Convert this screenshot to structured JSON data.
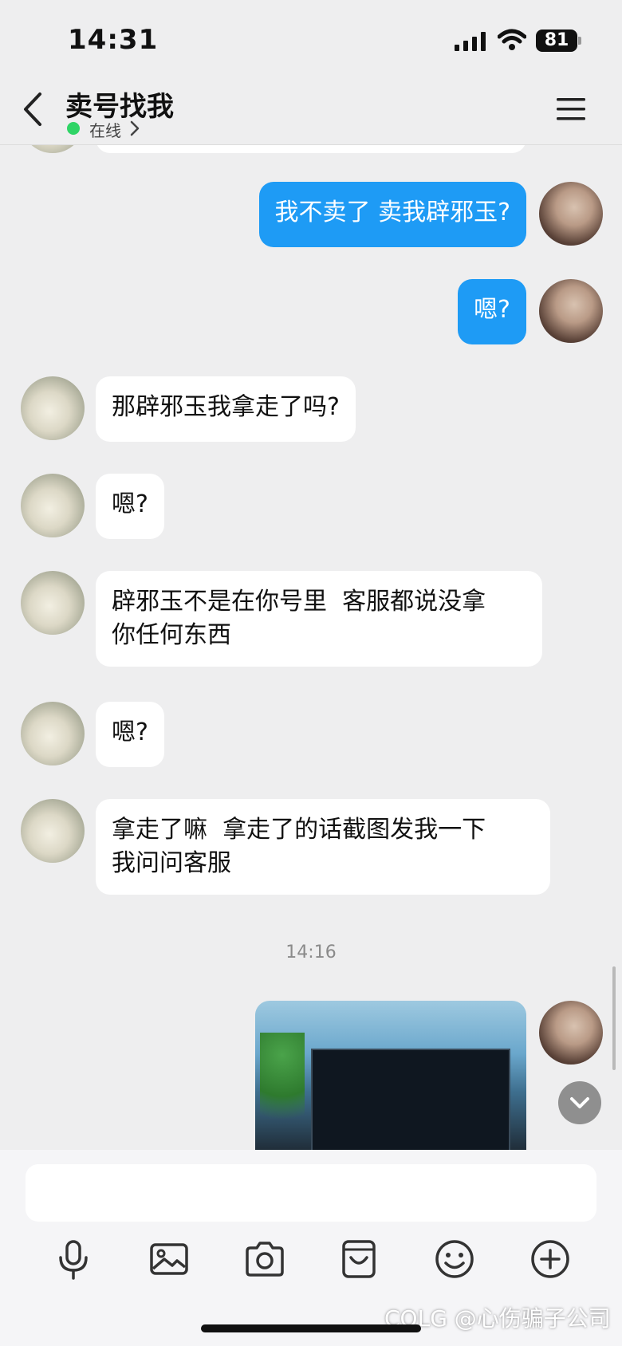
{
  "status_bar": {
    "time": "14:31",
    "battery": "81"
  },
  "header": {
    "title": "卖号找我",
    "status": "在线"
  },
  "messages": [
    {
      "side": "self",
      "text": "我不卖了 卖我辟邪玉?"
    },
    {
      "side": "self",
      "text": "嗯?"
    },
    {
      "side": "other",
      "text": "那辟邪玉我拿走了吗?"
    },
    {
      "side": "other",
      "text": "嗯?"
    },
    {
      "side": "other",
      "text": "辟邪玉不是在你号里  客服都说没拿\n你任何东西"
    },
    {
      "side": "other",
      "text": "嗯?"
    },
    {
      "side": "other",
      "text": "拿走了嘛  拿走了的话截图发我一下\n我问问客服"
    }
  ],
  "timestamp": "14:16",
  "composer": {
    "placeholder": ""
  },
  "watermark": "COLG @心伤骗子公司",
  "icons": [
    "back-icon",
    "menu-icon",
    "microphone-icon",
    "image-icon",
    "camera-icon",
    "sticker-icon",
    "emoji-icon",
    "plus-icon",
    "chevron-down-icon"
  ],
  "colors": {
    "self_bubble": "#1e9bf5",
    "other_bubble": "#ffffff",
    "online": "#2fd466",
    "background": "#eeeeef"
  }
}
